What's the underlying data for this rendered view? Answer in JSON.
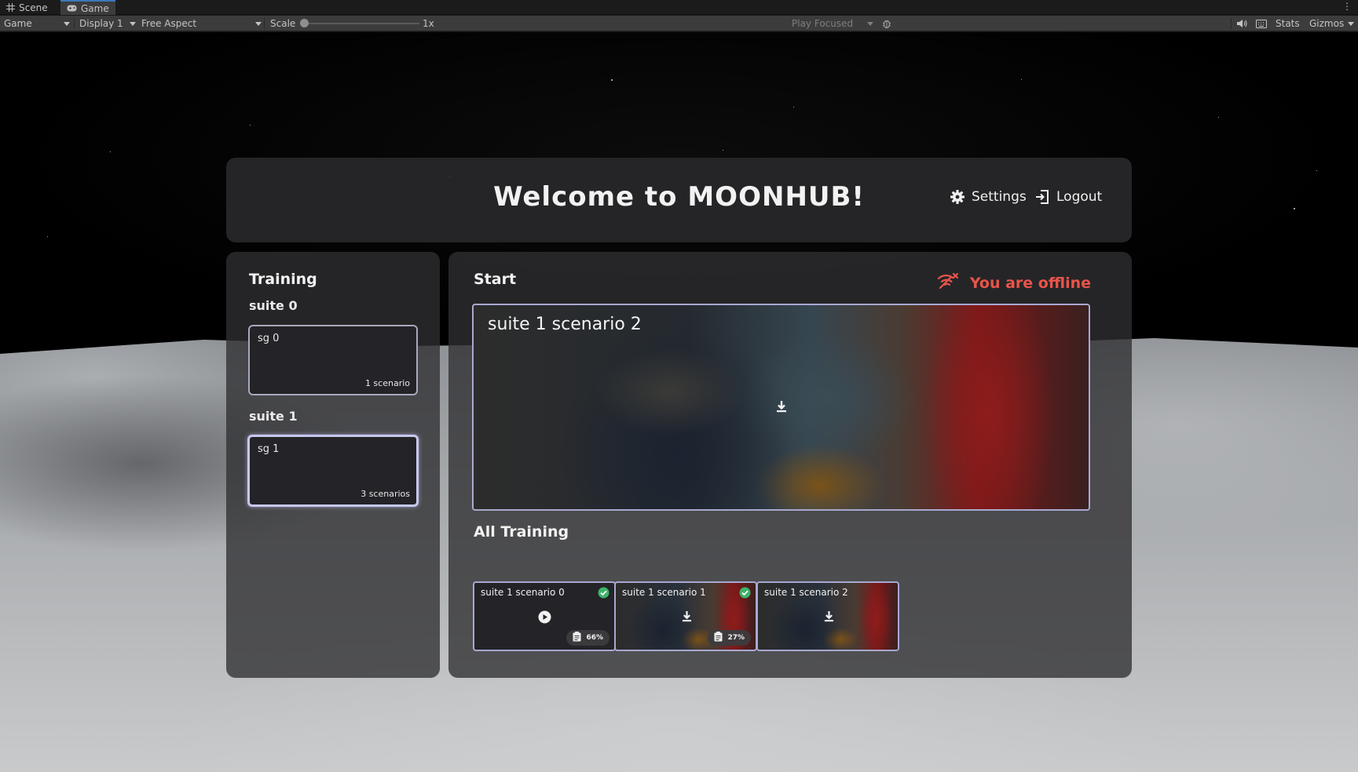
{
  "editor": {
    "tabs": [
      {
        "label": "Scene",
        "icon": "grid-icon"
      },
      {
        "label": "Game",
        "icon": "gamepad-icon"
      }
    ],
    "toolbar": {
      "view_select": "Game",
      "display_select": "Display 1",
      "aspect_select": "Free Aspect",
      "scale_label": "Scale",
      "scale_value": "1x",
      "play_mode_select": "Play Focused",
      "stats_label": "Stats",
      "gizmos_label": "Gizmos"
    }
  },
  "app": {
    "title": "Welcome to MOONHUB!",
    "settings_label": "Settings",
    "logout_label": "Logout"
  },
  "training": {
    "heading": "Training",
    "suites": [
      {
        "label": "suite 0",
        "group": {
          "name": "sg 0",
          "count": "1 scenario",
          "selected": false
        }
      },
      {
        "label": "suite 1",
        "group": {
          "name": "sg 1",
          "count": "3 scenarios",
          "selected": true
        }
      }
    ]
  },
  "start": {
    "heading": "Start",
    "offline_text": "You are offline",
    "featured": {
      "title": "suite 1 scenario 2"
    }
  },
  "all_training": {
    "heading": "All Training",
    "cards": [
      {
        "name": "suite 1 scenario 0",
        "completed": true,
        "action": "play",
        "progress": "66%"
      },
      {
        "name": "suite 1 scenario 1",
        "completed": true,
        "action": "download",
        "progress": "27%"
      },
      {
        "name": "suite 1 scenario 2",
        "completed": false,
        "action": "download",
        "progress": ""
      }
    ]
  },
  "colors": {
    "offline_red": "#e8544a",
    "check_green": "#3db36a",
    "card_border": "#a8a8d0"
  }
}
